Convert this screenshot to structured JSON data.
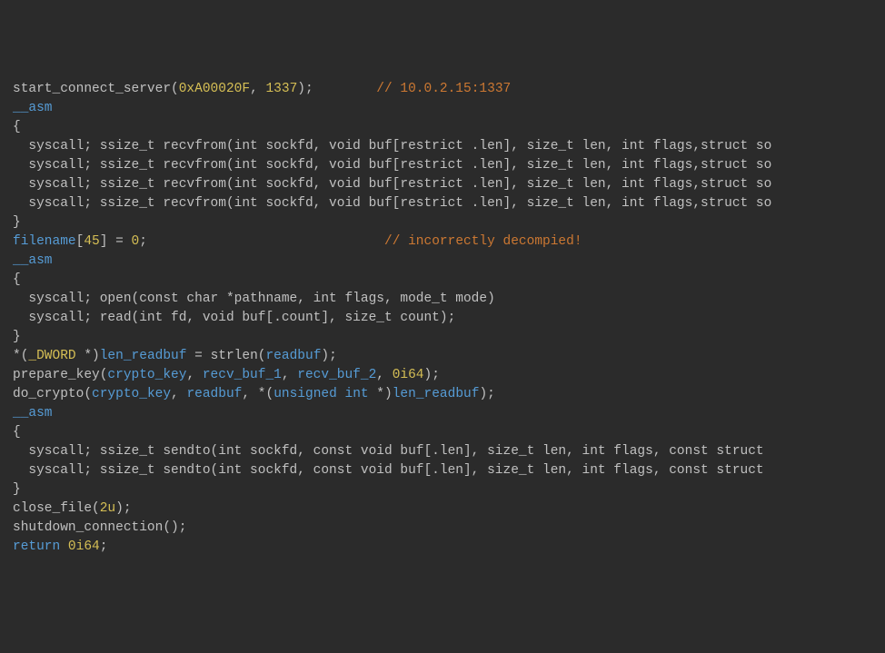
{
  "lines": {
    "l1_func": "start_connect_server",
    "l1_arg1": "0xA00020F",
    "l1_arg2": "1337",
    "l1_comment": "// 10.0.2.15:1337",
    "l2": "__asm",
    "l3": "{",
    "l4": "  syscall; ssize_t recvfrom(int sockfd, void buf[restrict .len], size_t len, int flags,struct so",
    "l5": "  syscall; ssize_t recvfrom(int sockfd, void buf[restrict .len], size_t len, int flags,struct so",
    "l6": "  syscall; ssize_t recvfrom(int sockfd, void buf[restrict .len], size_t len, int flags,struct so",
    "l7": "  syscall; ssize_t recvfrom(int sockfd, void buf[restrict .len], size_t len, int flags,struct so",
    "l8": "}",
    "l9_var": "filename",
    "l9_idx": "45",
    "l9_val": "0",
    "l9_comment": "// incorrectly decompied!",
    "l10": "__asm",
    "l11": "{",
    "l12": "  syscall; open(const char *pathname, int flags, mode_t mode)",
    "l13": "  syscall; read(int fd, void buf[.count], size_t count);",
    "l14": "}",
    "l15_cast": "_DWORD",
    "l15_var1": "len_readbuf",
    "l15_func": "strlen",
    "l15_arg": "readbuf",
    "l16_func": "prepare_key",
    "l16_a1": "crypto_key",
    "l16_a2": "recv_buf_1",
    "l16_a3": "recv_buf_2",
    "l16_a4": "0i64",
    "l17_func": "do_crypto",
    "l17_a1": "crypto_key",
    "l17_a2": "readbuf",
    "l17_cast": "unsigned int",
    "l17_a3": "len_readbuf",
    "l18": "__asm",
    "l19": "{",
    "l20": "  syscall; ssize_t sendto(int sockfd, const void buf[.len], size_t len, int flags, const struct ",
    "l21": "  syscall; ssize_t sendto(int sockfd, const void buf[.len], size_t len, int flags, const struct ",
    "l22": "}",
    "l23_func": "close_file",
    "l23_arg": "2u",
    "l24_func": "shutdown_connection",
    "l25_kw": "return",
    "l25_val": "0i64"
  }
}
